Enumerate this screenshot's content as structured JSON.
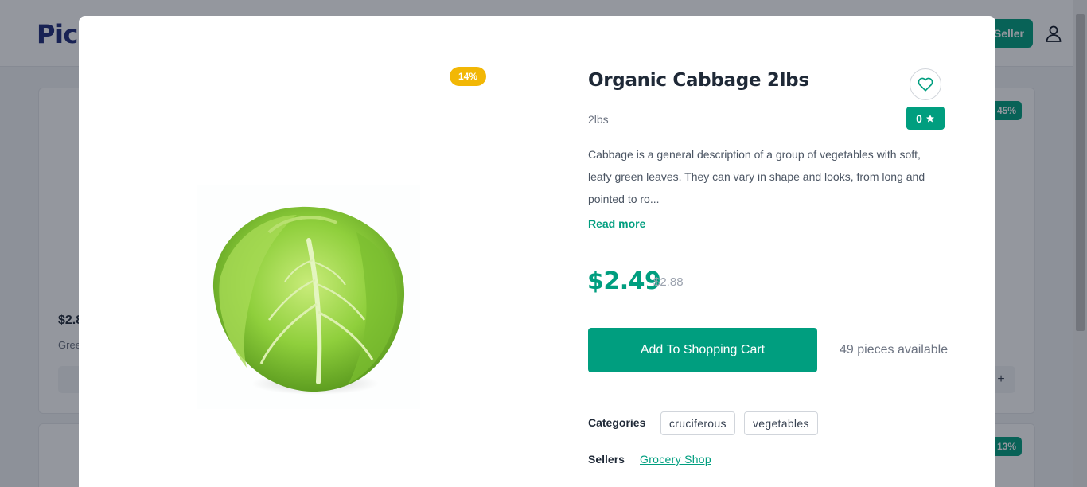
{
  "background": {
    "logo_text": "Pick",
    "seller_button_label": "Seller",
    "user_icon": "user-icon",
    "card_price": "$2.8",
    "card_subtitle": "Gree",
    "badge_top": "45%",
    "badge_bottom": "13%",
    "plus_label": "+"
  },
  "modal": {
    "discount_badge": "14%",
    "image": "cabbage-image",
    "title": "Organic Cabbage 2lbs",
    "unit": "2lbs",
    "favorite_icon": "heart-icon",
    "rating": "0",
    "rating_icon": "star-icon",
    "description": "Cabbage is a general description of a group of vegetables with soft, leafy green leaves. They can vary in shape and looks, from long and pointed to ro...",
    "read_more": "Read more",
    "price": "$2.49",
    "old_price": "$2.88",
    "add_to_cart": "Add To Shopping Cart",
    "stock": "49 pieces available",
    "categories_label": "Categories",
    "categories": [
      "cruciferous",
      "vegetables"
    ],
    "sellers_label": "Sellers",
    "seller_name": "Grocery Shop"
  },
  "colors": {
    "accent": "#009e7f",
    "discount": "#f2b705",
    "overlay": "rgba(17,24,39,0.45)"
  }
}
